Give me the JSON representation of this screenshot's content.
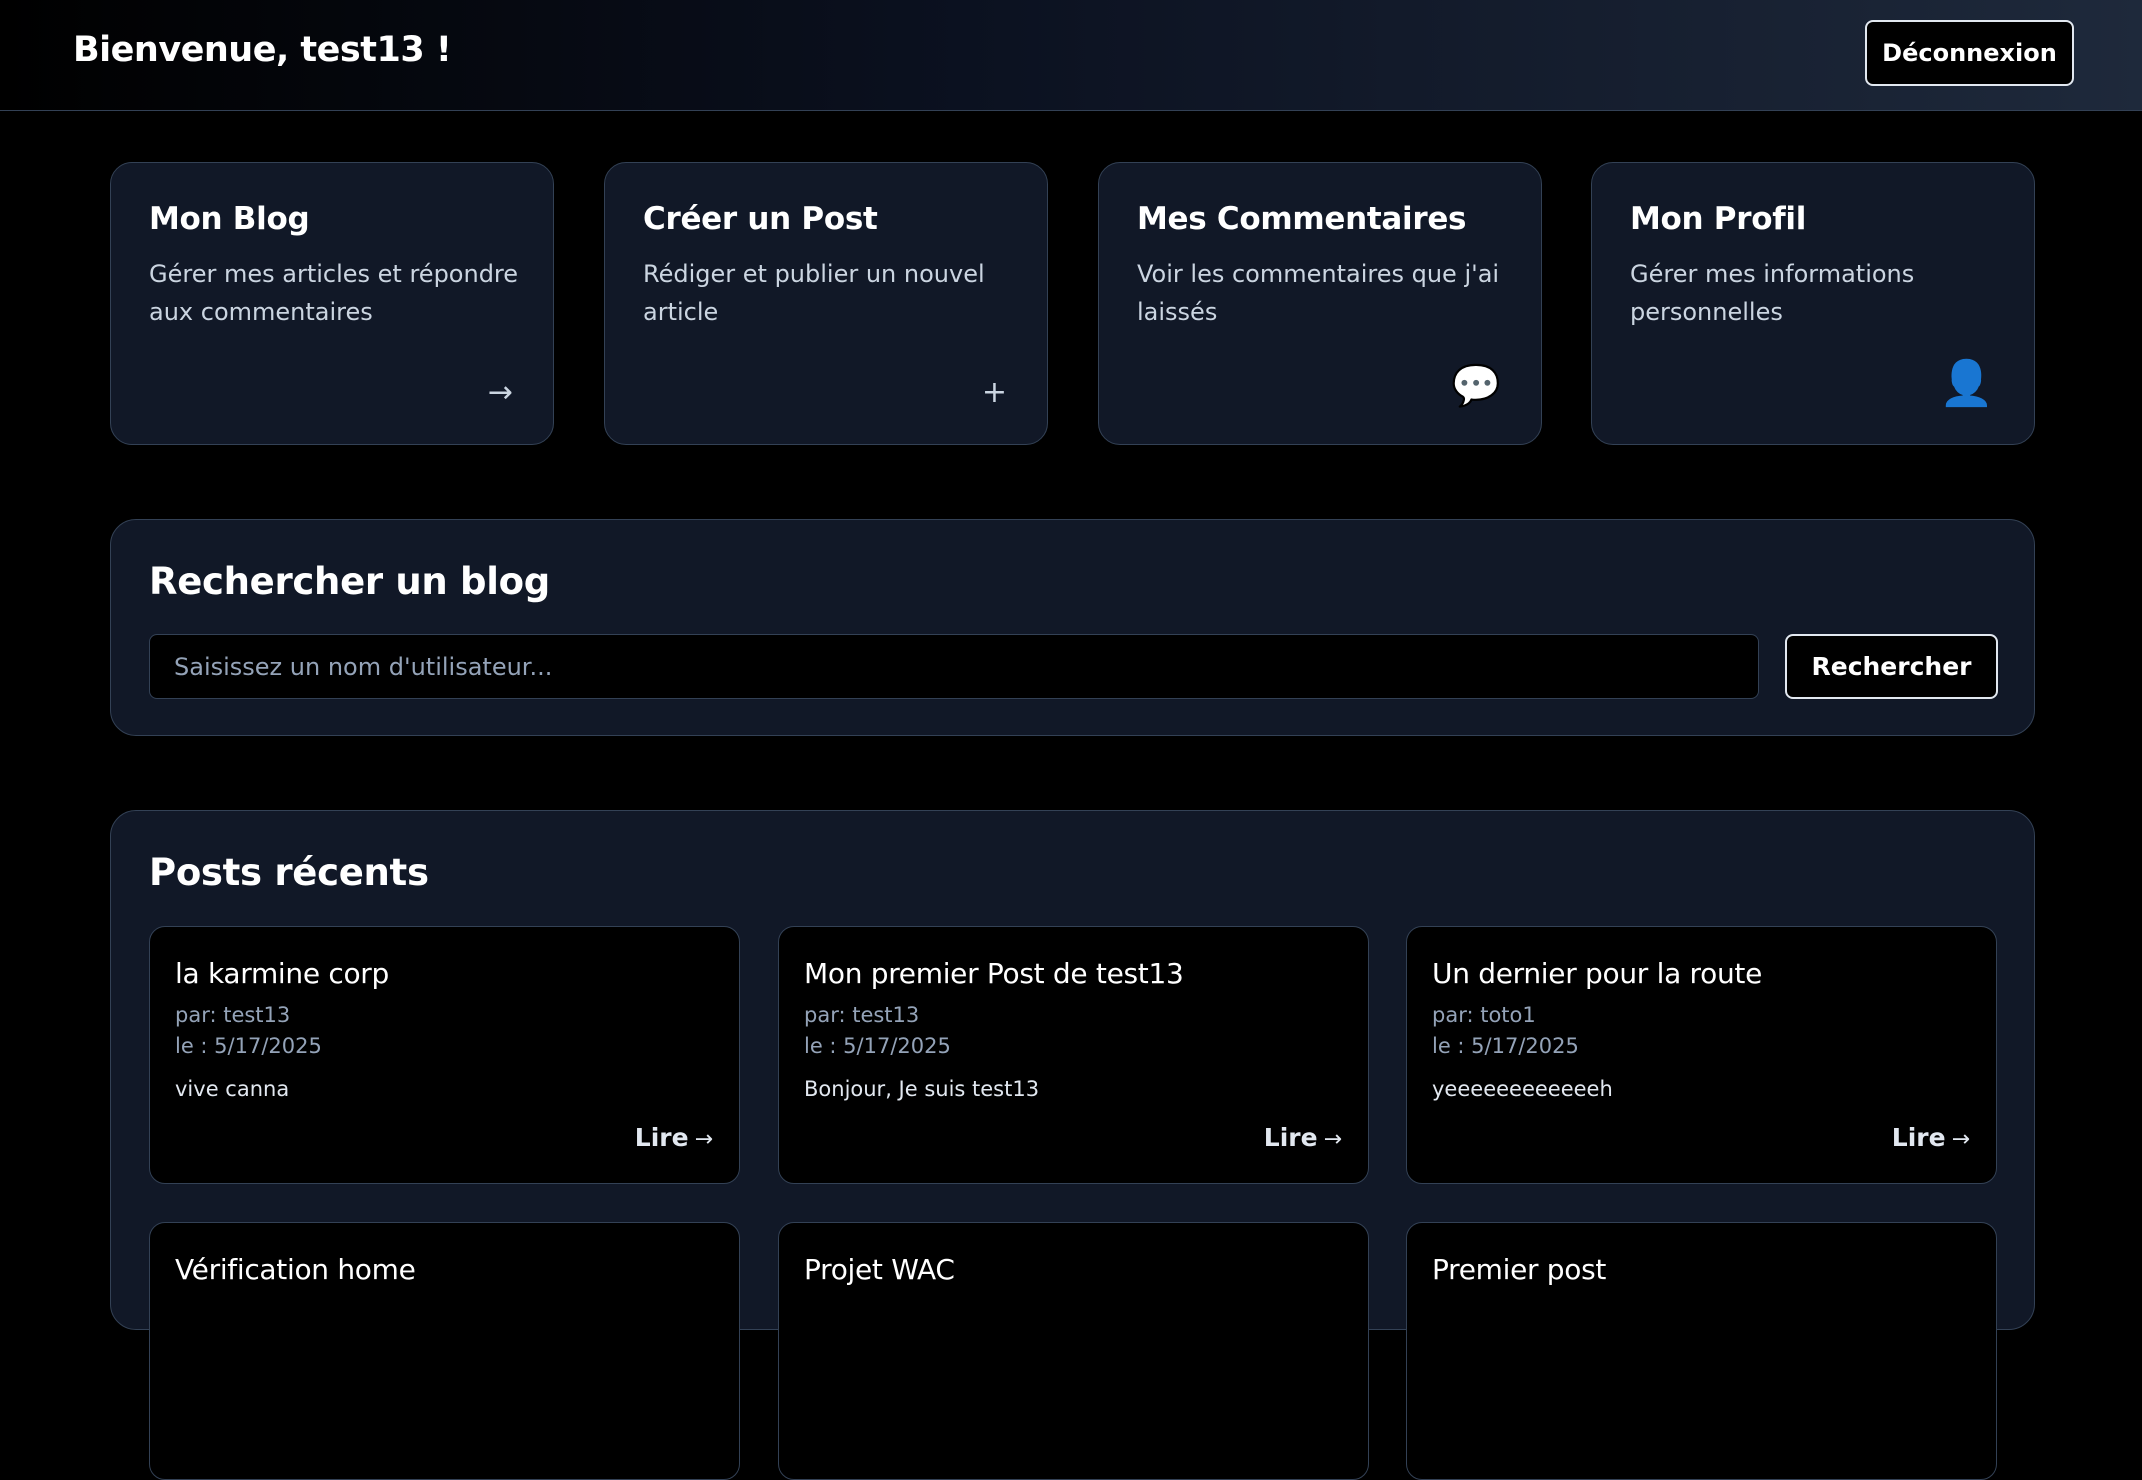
{
  "header": {
    "welcome": "Bienvenue, test13 !",
    "logout_label": "Déconnexion"
  },
  "cards": [
    {
      "title": "Mon Blog",
      "description": "Gérer mes articles et répondre aux commentaires",
      "icon": "arrow-right-icon",
      "glyph": "→"
    },
    {
      "title": "Créer un Post",
      "description": "Rédiger et publier un nouvel article",
      "icon": "plus-icon",
      "glyph": "+"
    },
    {
      "title": "Mes Commentaires",
      "description": "Voir les commentaires que j'ai laissés",
      "icon": "speech-bubble-icon",
      "glyph": "💬"
    },
    {
      "title": "Mon Profil",
      "description": "Gérer mes informations personnelles",
      "icon": "user-icon",
      "glyph": "👤"
    }
  ],
  "search": {
    "title": "Rechercher un blog",
    "placeholder": "Saisissez un nom d'utilisateur...",
    "value": "",
    "button_label": "Rechercher"
  },
  "recent": {
    "title": "Posts récents",
    "read_label": "Lire",
    "read_arrow": "→",
    "posts": [
      {
        "title": "la karmine corp",
        "author": "par: test13",
        "date": "le : 5/17/2025",
        "excerpt": "vive canna"
      },
      {
        "title": "Mon premier Post de test13",
        "author": "par: test13",
        "date": "le : 5/17/2025",
        "excerpt": "Bonjour, Je suis test13"
      },
      {
        "title": "Un dernier pour la route",
        "author": "par: toto1",
        "date": "le : 5/17/2025",
        "excerpt": "yeeeeeeeeeeeeh"
      },
      {
        "title": "Vérification home"
      },
      {
        "title": "Projet WAC"
      },
      {
        "title": "Premier post"
      }
    ]
  },
  "colors": {
    "background": "#000000",
    "panel": "#111827",
    "border": "#334155",
    "muted_text": "#94a3b8",
    "accent_blue": "#2563eb"
  }
}
